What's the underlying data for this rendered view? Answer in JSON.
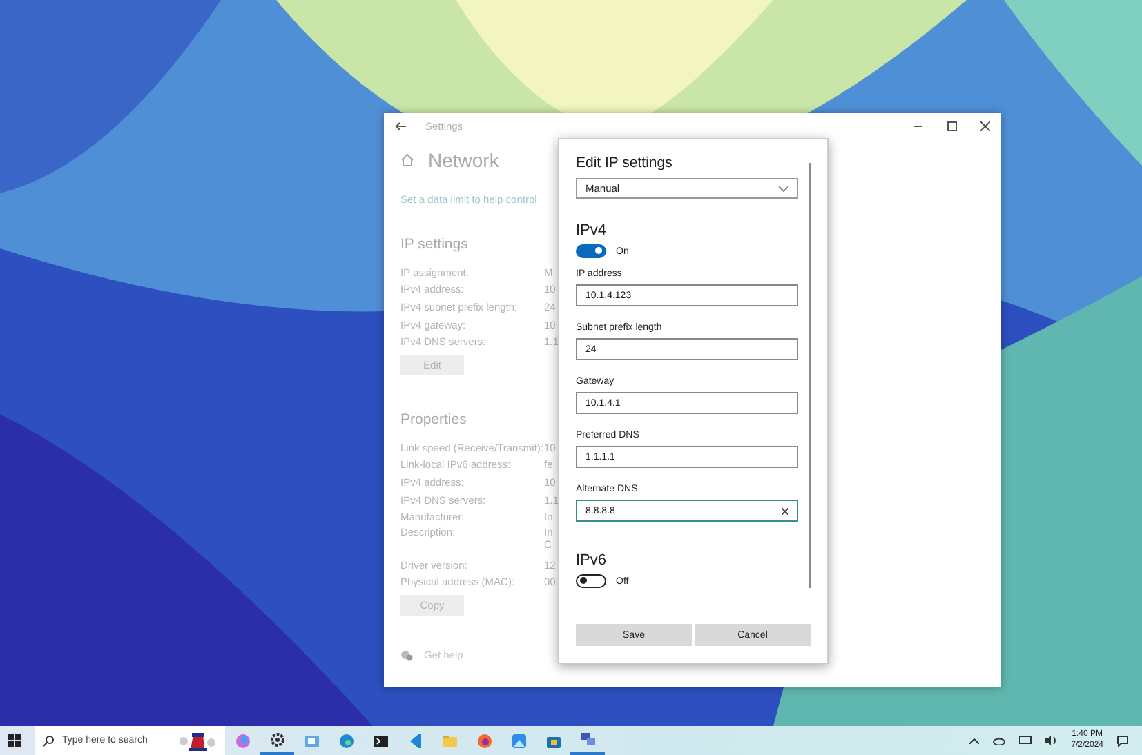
{
  "window": {
    "title": "Settings",
    "heading": "Network",
    "link": "Set a data limit to help control",
    "ip_settings": {
      "title": "IP settings",
      "rows": [
        {
          "label": "IP assignment:",
          "value": "M"
        },
        {
          "label": "IPv4 address:",
          "value": "10"
        },
        {
          "label": "IPv4 subnet prefix length:",
          "value": "24"
        },
        {
          "label": "IPv4 gateway:",
          "value": "10"
        },
        {
          "label": "IPv4 DNS servers:",
          "value": "1.1"
        }
      ],
      "button": "Edit"
    },
    "properties": {
      "title": "Properties",
      "rows": [
        {
          "label": "Link speed (Receive/Transmit):",
          "value": "10"
        },
        {
          "label": "Link-local IPv6 address:",
          "value": "fe"
        },
        {
          "label": "IPv4 address:",
          "value": "10"
        },
        {
          "label": "IPv4 DNS servers:",
          "value": "1.1"
        },
        {
          "label": "Manufacturer:",
          "value": "In"
        },
        {
          "label": "Description:",
          "value": "In",
          "continuation": "C"
        },
        {
          "label": "Driver version:",
          "value": "12"
        },
        {
          "label": "Physical address (MAC):",
          "value": "00"
        }
      ],
      "button": "Copy"
    },
    "help": "Get help"
  },
  "dialog": {
    "title": "Edit IP settings",
    "mode": "Manual",
    "ipv4": {
      "title": "IPv4",
      "on": true,
      "state_label": "On",
      "fields": [
        {
          "label": "IP address",
          "value": "10.1.4.123",
          "focused": false
        },
        {
          "label": "Subnet prefix length",
          "value": "24",
          "focused": false
        },
        {
          "label": "Gateway",
          "value": "10.1.4.1",
          "focused": false
        },
        {
          "label": "Preferred DNS",
          "value": "1.1.1.1",
          "focused": false
        },
        {
          "label": "Alternate DNS",
          "value": "8.8.8.8",
          "focused": true
        }
      ]
    },
    "ipv6": {
      "title": "IPv6",
      "on": false,
      "state_label": "Off"
    },
    "buttons": [
      "Save",
      "Cancel"
    ]
  },
  "taskbar": {
    "search": {
      "placeholder": "Type here to search"
    },
    "time": "1:40 PM",
    "date": "7/2/2024"
  }
}
